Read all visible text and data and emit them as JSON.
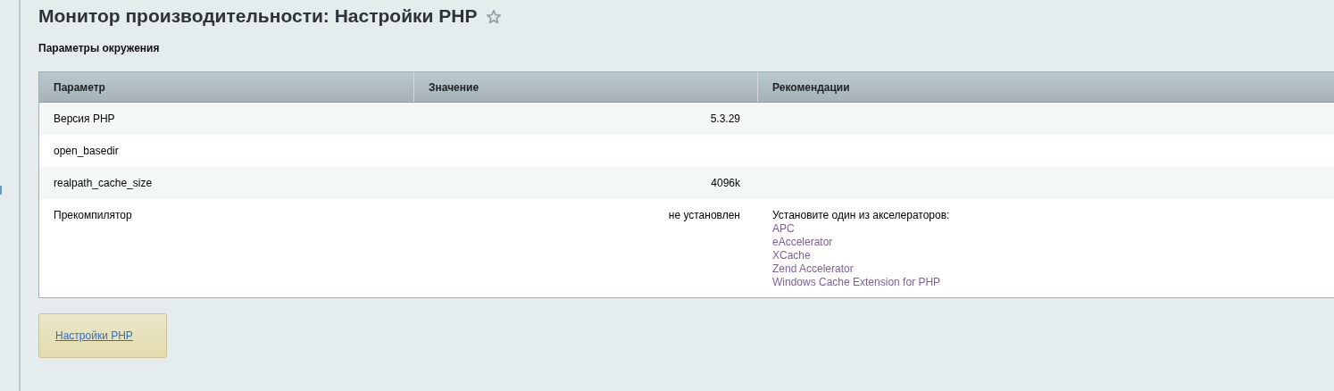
{
  "page": {
    "title": "Монитор производительности: Настройки PHP",
    "favorite": false
  },
  "section_title": "Параметры окружения",
  "table": {
    "columns": [
      "Параметр",
      "Значение",
      "Рекомендации"
    ],
    "rows": [
      {
        "parameter": "Версия PHP",
        "value": "5.3.29"
      },
      {
        "parameter": "open_basedir"
      },
      {
        "parameter": "realpath_cache_size",
        "value": "4096k"
      },
      {
        "parameter": "Прекомпилятор",
        "value": "не установлен",
        "recommendation": {
          "text": "Установите один из акселераторов:",
          "links": [
            "APC",
            "eAccelerator",
            "XCache",
            "Zend Accelerator",
            "Windows Cache Extension for PHP"
          ]
        }
      }
    ]
  },
  "button": {
    "label": "Настройки PHP"
  }
}
